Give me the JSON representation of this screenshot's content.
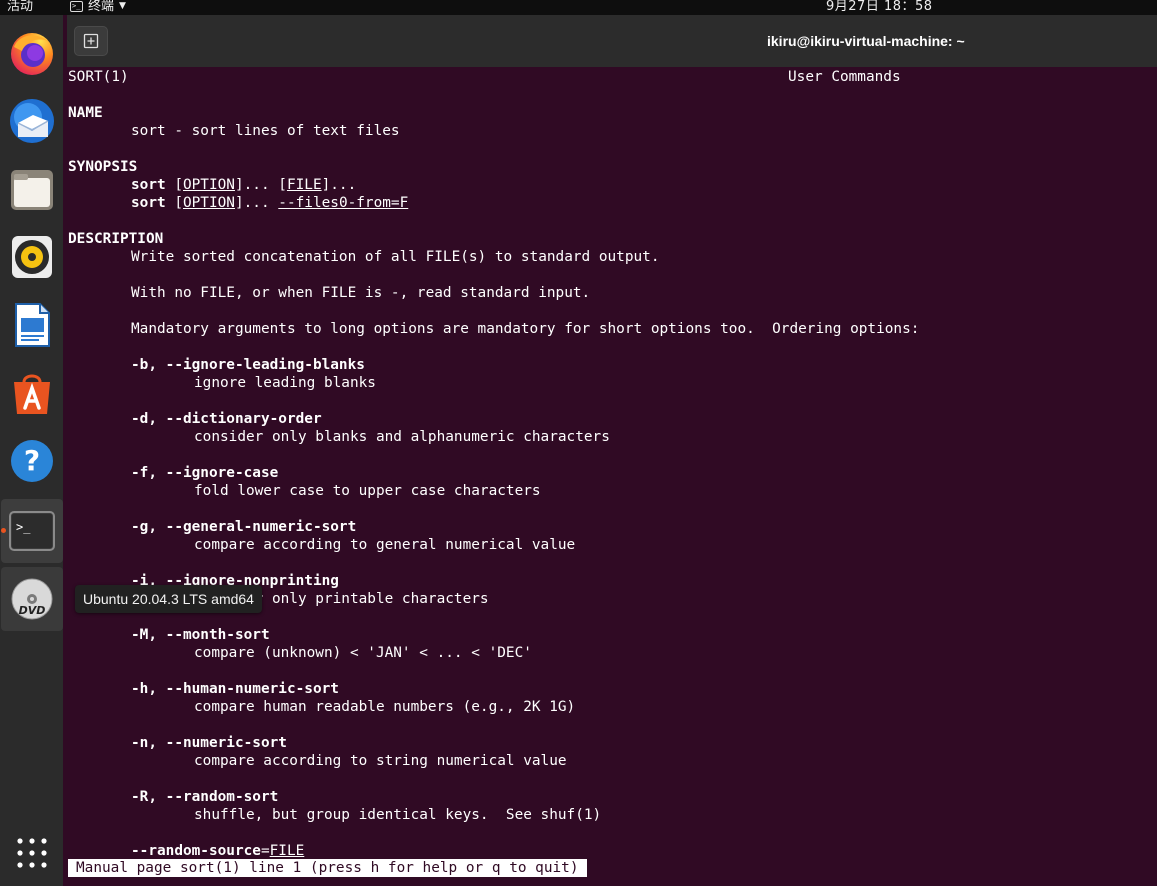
{
  "topbar": {
    "activities": "活动",
    "app_name": "终端",
    "clock": "9月27日  18：58"
  },
  "dock": {
    "items": [
      {
        "icon": "firefox-icon"
      },
      {
        "icon": "thunderbird-icon"
      },
      {
        "icon": "files-icon"
      },
      {
        "icon": "rhythmbox-icon"
      },
      {
        "icon": "libreoffice-writer-icon"
      },
      {
        "icon": "ubuntu-software-icon"
      },
      {
        "icon": "help-icon"
      },
      {
        "icon": "terminal-icon",
        "active": true
      },
      {
        "icon": "dvd-icon"
      }
    ],
    "show_apps_icon": "app-grid-icon",
    "tooltip": "Ubuntu 20.04.3 LTS amd64",
    "accent_color": "#e95420"
  },
  "terminal": {
    "title": "ikiru@ikiru-virtual-machine: ~",
    "background": "#300a24",
    "header_left": "SORT(1)",
    "header_center": "User Commands",
    "name_heading": "NAME",
    "name_text": "sort - sort lines of text files",
    "synopsis_heading": "SYNOPSIS",
    "synopsis": [
      {
        "cmd": "sort",
        "p1": " [",
        "opt": "OPTION",
        "p2": "]... [",
        "arg": "FILE",
        "p3": "]..."
      },
      {
        "cmd": "sort",
        "p1": " [",
        "opt": "OPTION",
        "p2": "]... ",
        "arg": "--files0-from=F",
        "p3": ""
      }
    ],
    "description_heading": "DESCRIPTION",
    "desc_lines": [
      "Write sorted concatenation of all FILE(s) to standard output.",
      "With no FILE, or when FILE is -, read standard input.",
      "Mandatory arguments to long options are mandatory for short options too.  Ordering options:"
    ],
    "options": [
      {
        "flag": "-b, --ignore-leading-blanks",
        "desc": "ignore leading blanks"
      },
      {
        "flag": "-d, --dictionary-order",
        "desc": "consider only blanks and alphanumeric characters"
      },
      {
        "flag": "-f, --ignore-case",
        "desc": "fold lower case to upper case characters"
      },
      {
        "flag": "-g, --general-numeric-sort",
        "desc": "compare according to general numerical value"
      },
      {
        "flag": "-i, --ignore-nonprinting",
        "desc": "consider only printable characters"
      },
      {
        "flag": "-M, --month-sort",
        "desc": "compare (unknown) < 'JAN' < ... < 'DEC'"
      },
      {
        "flag": "-h, --human-numeric-sort",
        "desc": "compare human readable numbers (e.g., 2K 1G)"
      },
      {
        "flag": "-n, --numeric-sort",
        "desc": "compare according to string numerical value"
      },
      {
        "flag": "-R, --random-sort",
        "desc": "shuffle, but group identical keys.  See shuf(1)"
      }
    ],
    "last_flag": "--random-source",
    "last_flag_eq": "=",
    "last_flag_arg": "FILE",
    "status": "Manual page sort(1) line 1 (press h for help or q to quit)"
  }
}
